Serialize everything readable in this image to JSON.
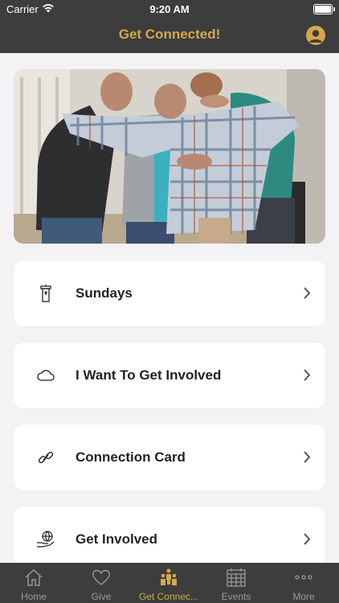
{
  "status_bar": {
    "carrier": "Carrier",
    "time": "9:20 AM"
  },
  "header": {
    "title": "Get Connected!",
    "profile_icon": "person-circle-icon"
  },
  "hero_image": {
    "description_icon": "group-hug-photo"
  },
  "menu": {
    "items": [
      {
        "label": "Sundays",
        "icon": "church-pulpit-icon"
      },
      {
        "label": "I Want To Get Involved",
        "icon": "cloud-icon"
      },
      {
        "label": "Connection Card",
        "icon": "link-icon"
      },
      {
        "label": "Get Involved",
        "icon": "globe-in-hand-icon"
      }
    ]
  },
  "tab_bar": {
    "tabs": [
      {
        "label": "Home",
        "icon": "home-icon"
      },
      {
        "label": "Give",
        "icon": "heart-icon"
      },
      {
        "label": "Get Connec...",
        "icon": "people-group-icon",
        "active": true
      },
      {
        "label": "Events",
        "icon": "calendar-icon"
      },
      {
        "label": "More",
        "icon": "ellipsis-icon"
      }
    ]
  },
  "colors": {
    "bar_background": "#3d3d3d",
    "accent_gold": "#d4a84a",
    "page_background": "#f3f3f6",
    "inactive_tab": "#9a9a9a"
  }
}
